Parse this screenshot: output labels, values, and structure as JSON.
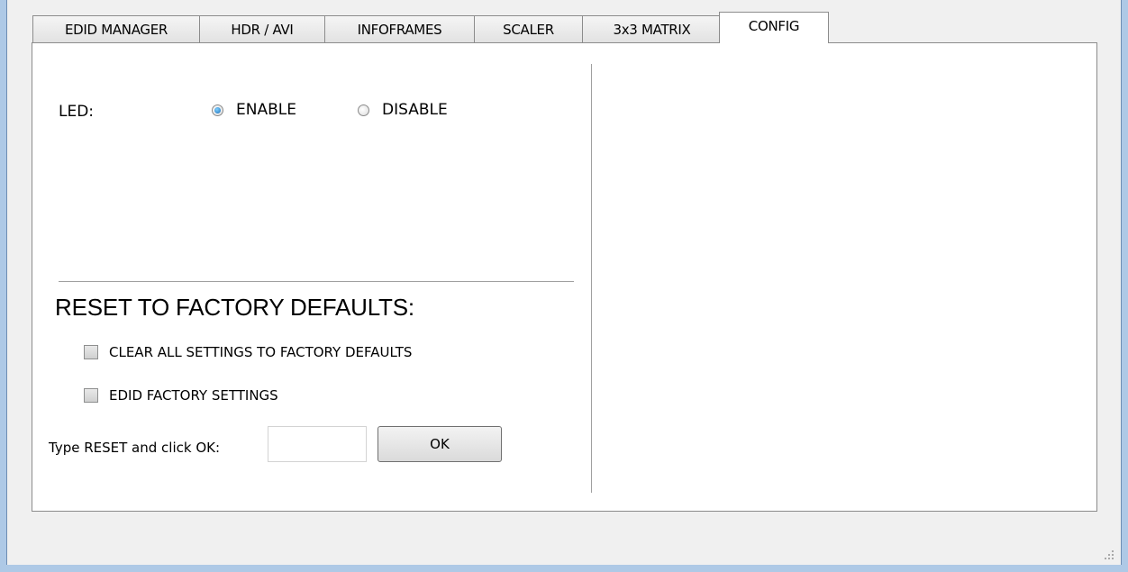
{
  "tabs": [
    {
      "label": "EDID MANAGER"
    },
    {
      "label": "HDR / AVI"
    },
    {
      "label": "INFOFRAMES"
    },
    {
      "label": "SCALER"
    },
    {
      "label": "3x3 MATRIX"
    },
    {
      "label": "CONFIG",
      "active": true
    }
  ],
  "led": {
    "label": "LED:",
    "options": [
      {
        "label": "ENABLE",
        "selected": true
      },
      {
        "label": "DISABLE",
        "selected": false
      }
    ]
  },
  "reset": {
    "heading": "RESET TO FACTORY DEFAULTS:",
    "checkboxes": [
      {
        "label": "CLEAR ALL SETTINGS TO FACTORY DEFAULTS",
        "checked": false
      },
      {
        "label": "EDID FACTORY SETTINGS",
        "checked": false
      }
    ],
    "prompt_label": "Type RESET and click OK:",
    "input_value": "",
    "ok_label": "OK"
  },
  "colors": {
    "window_border": "#aec9e6",
    "radio_selected": "#1d6fb8"
  }
}
